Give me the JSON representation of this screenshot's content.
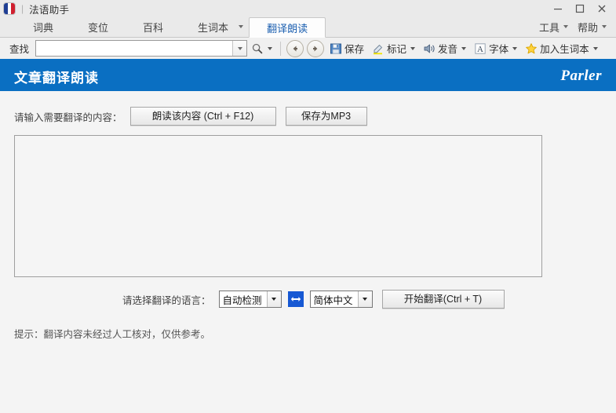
{
  "window": {
    "app_icon": "french-flag-icon",
    "separator": "|",
    "title": "法语助手",
    "controls": {
      "minimize": "minimize-icon",
      "maximize": "maximize-icon",
      "close": "close-icon"
    }
  },
  "tabs": [
    {
      "label": "词典",
      "active": false,
      "has_caret": false
    },
    {
      "label": "变位",
      "active": false,
      "has_caret": false
    },
    {
      "label": "百科",
      "active": false,
      "has_caret": false
    },
    {
      "label": "生词本",
      "active": false,
      "has_caret": true
    },
    {
      "label": "翻译朗读",
      "active": true,
      "has_caret": false
    }
  ],
  "menus": [
    {
      "label": "工具"
    },
    {
      "label": "帮助"
    }
  ],
  "toolbar": {
    "search_label": "查找",
    "search_value": "",
    "search_placeholder": "",
    "buttons": [
      {
        "label": "保存",
        "icon": "floppy-disk-icon",
        "has_caret": false
      },
      {
        "label": "标记",
        "icon": "highlighter-icon",
        "has_caret": true
      },
      {
        "label": "发音",
        "icon": "speaker-icon",
        "has_caret": true
      },
      {
        "label": "字体",
        "icon": "font-letter-a-icon",
        "has_caret": true
      },
      {
        "label": "加入生词本",
        "icon": "star-icon",
        "has_caret": true
      }
    ],
    "nav_back": "arrow-left-icon",
    "nav_forward": "arrow-right-icon",
    "search_icon": "magnifier-icon"
  },
  "banner": {
    "title": "文章翻译朗读",
    "brand": "Parler",
    "color": "#0a6fc2"
  },
  "form": {
    "input_label": "请输入需要翻译的内容：",
    "speak_button": "朗读该内容 (Ctrl + F12)",
    "mp3_button": "保存为MP3",
    "textarea_value": "",
    "textarea_placeholder": "",
    "lang_label": "请选择翻译的语言：",
    "source_lang": "自动检测",
    "target_lang": "简体中文",
    "swap_icon": "swap-horizontal-icon",
    "translate_button": "开始翻译(Ctrl + T)",
    "hint": "提示：翻译内容未经过人工核对，仅供参考。"
  }
}
